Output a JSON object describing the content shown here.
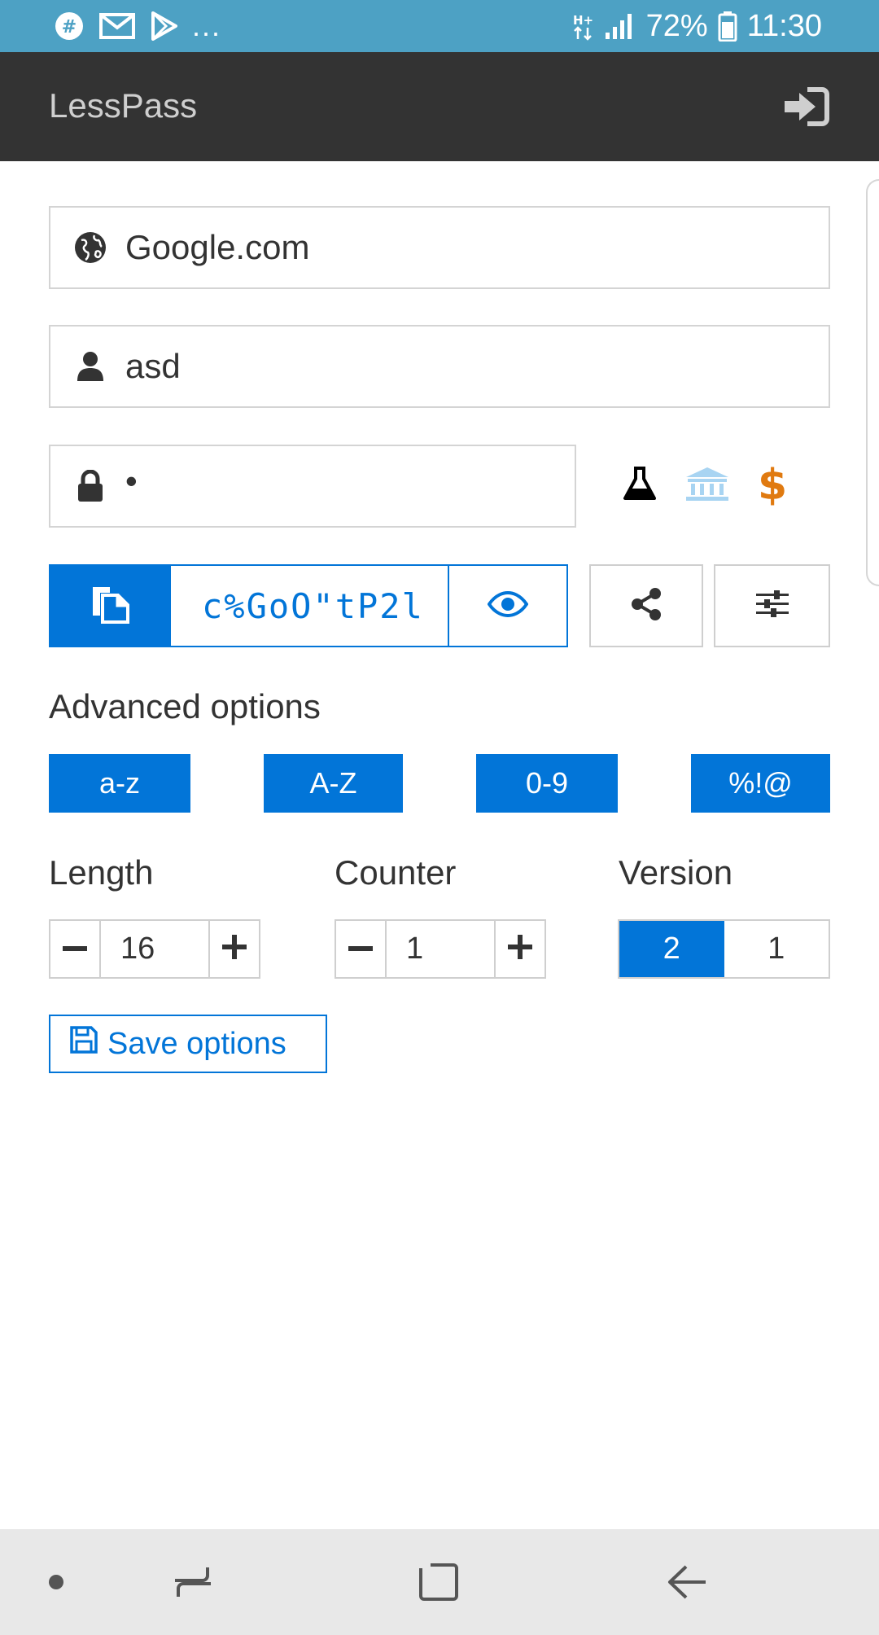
{
  "status_bar": {
    "notification_icons": [
      "slack-icon",
      "gmail-icon",
      "play-store-icon"
    ],
    "more": "...",
    "network": "H+",
    "battery_percent": "72%",
    "time": "11:30"
  },
  "app_bar": {
    "title": "LessPass",
    "signin_icon": "sign-in-icon"
  },
  "form": {
    "site": "Google.com",
    "login": "asd",
    "master_password": "•",
    "fingerprint": {
      "icons": [
        "flask-icon",
        "bank-icon",
        "dollar-icon"
      ],
      "colors": [
        "#000000",
        "#a8d4f2",
        "#e07a10"
      ],
      "dollar": "$"
    },
    "generated_password": "c%GoO\"tP2l"
  },
  "advanced": {
    "title": "Advanced options",
    "charsets": [
      "a-z",
      "A-Z",
      "0-9",
      "%!@"
    ],
    "length_label": "Length",
    "length_value": "16",
    "counter_label": "Counter",
    "counter_value": "1",
    "version_label": "Version",
    "version_options": [
      "2",
      "1"
    ],
    "version_selected": "2",
    "save_label": "Save options"
  },
  "colors": {
    "primary": "#0275d8",
    "status_bar": "#4da1c4",
    "app_bar": "#333333"
  }
}
